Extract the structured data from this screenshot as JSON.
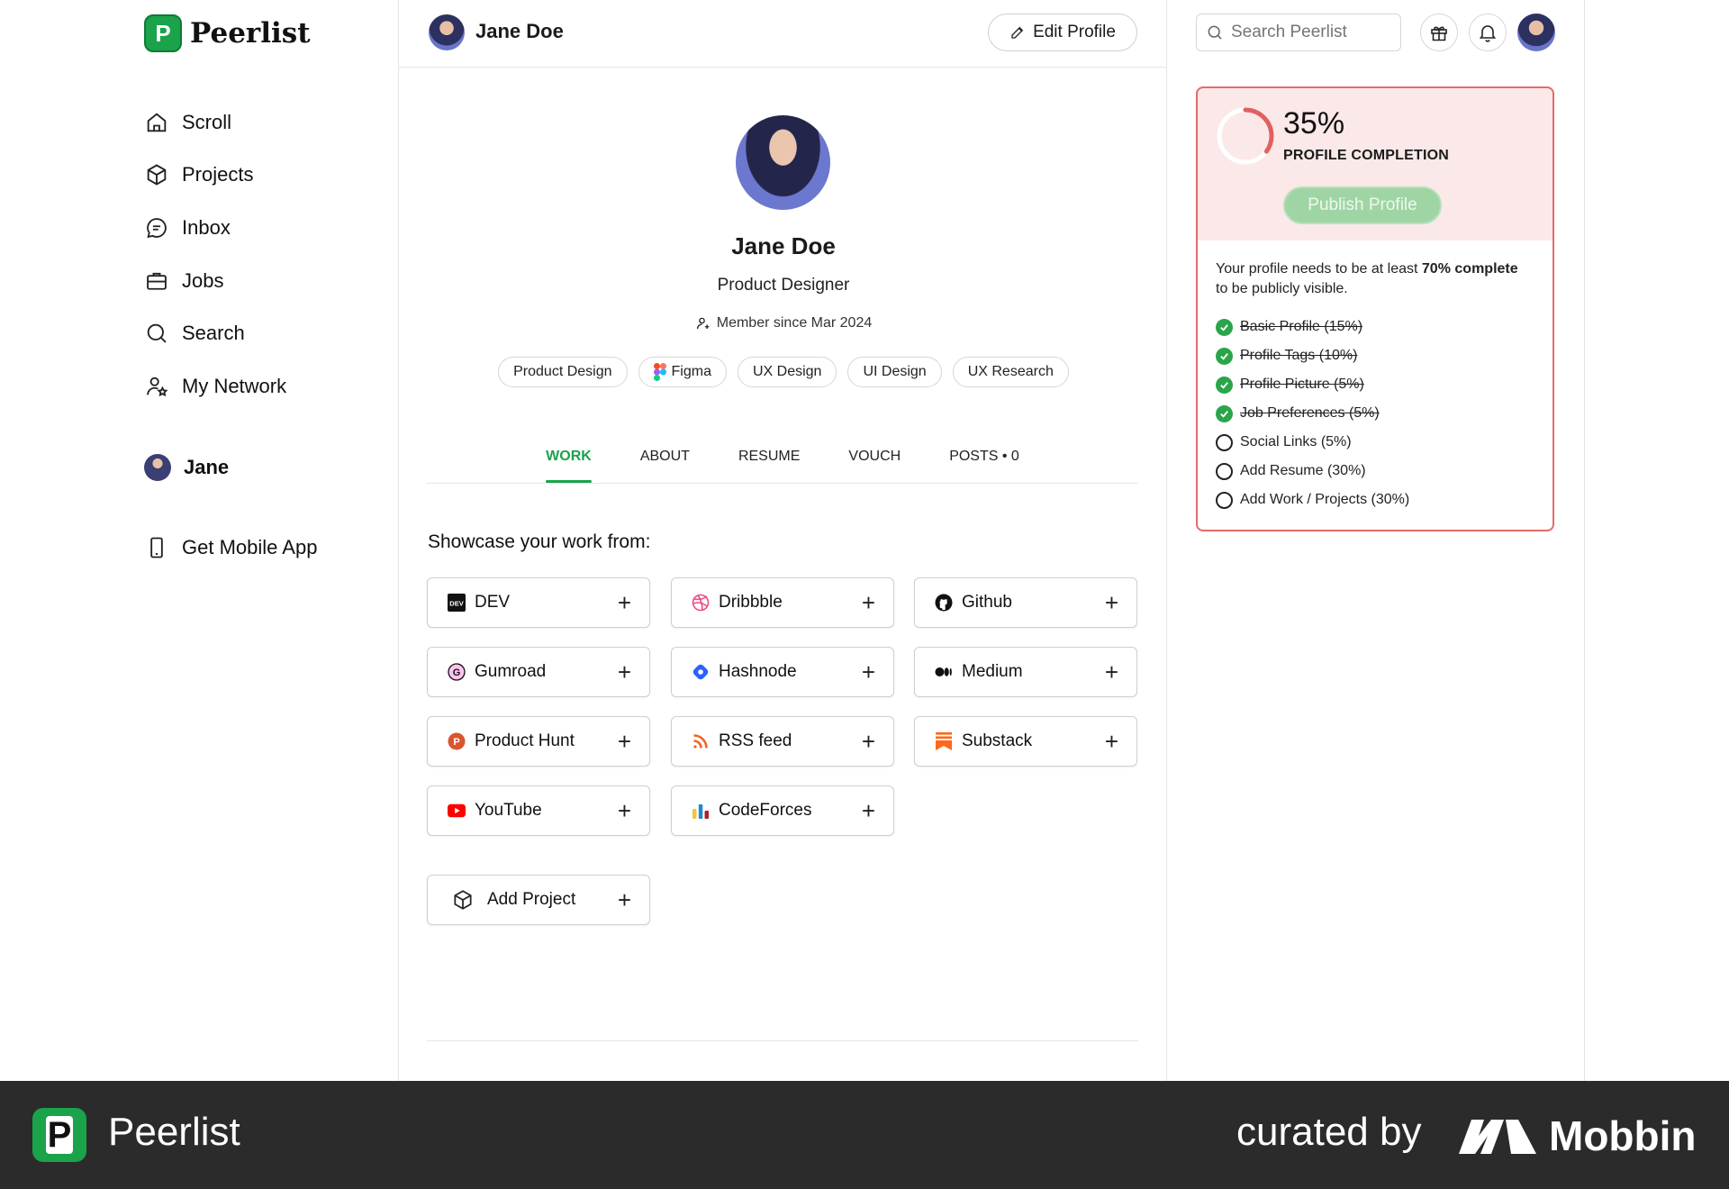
{
  "brand": {
    "name": "Peerlist",
    "logo_letter": "P"
  },
  "nav": {
    "items": [
      {
        "label": "Scroll",
        "icon": "home-icon"
      },
      {
        "label": "Projects",
        "icon": "cube-icon"
      },
      {
        "label": "Inbox",
        "icon": "chat-icon"
      },
      {
        "label": "Jobs",
        "icon": "briefcase-icon"
      },
      {
        "label": "Search",
        "icon": "search-icon"
      },
      {
        "label": "My Network",
        "icon": "network-icon"
      }
    ],
    "user": "Jane",
    "mobile_app": "Get Mobile App"
  },
  "header": {
    "name": "Jane Doe",
    "edit_label": "Edit Profile"
  },
  "search": {
    "placeholder": "Search Peerlist"
  },
  "profile": {
    "name": "Jane Doe",
    "role": "Product Designer",
    "member_since": "Member since Mar 2024",
    "tags": [
      "Product Design",
      "Figma",
      "UX Design",
      "UI Design",
      "UX Research"
    ]
  },
  "tabs": [
    "WORK",
    "ABOUT",
    "RESUME",
    "VOUCH",
    "POSTS • 0"
  ],
  "active_tab": "WORK",
  "showcase": {
    "title": "Showcase your work from:",
    "sources": [
      "DEV",
      "Dribbble",
      "Github",
      "Gumroad",
      "Hashnode",
      "Medium",
      "Product Hunt",
      "RSS feed",
      "Substack",
      "YouTube",
      "CodeForces"
    ],
    "add_project": "Add Project"
  },
  "completion": {
    "percent_text": "35%",
    "percent": 35,
    "label": "PROFILE COMPLETION",
    "publish_label": "Publish Profile",
    "need_prefix": "Your profile needs to be at least ",
    "need_bold1": "70%",
    "need_bold2": "complete",
    "need_suffix": " to be publicly visible.",
    "items": [
      {
        "label": "Basic Profile (15%)",
        "done": true
      },
      {
        "label": "Profile Tags (10%)",
        "done": true
      },
      {
        "label": "Profile Picture (5%)",
        "done": true
      },
      {
        "label": "Job Preferences (5%)",
        "done": true
      },
      {
        "label": "Social Links (5%)",
        "done": false
      },
      {
        "label": "Add Resume (30%)",
        "done": false
      },
      {
        "label": "Add Work / Projects (30%)",
        "done": false
      }
    ]
  },
  "footer": {
    "app_name": "Peerlist",
    "curated_by": "curated by",
    "curator": "Mobbin"
  },
  "colors": {
    "accent": "#1aa34a",
    "alert_border": "#e66a6a",
    "alert_bg": "#fbe8e8",
    "footer_bg": "#2b2b2b"
  }
}
